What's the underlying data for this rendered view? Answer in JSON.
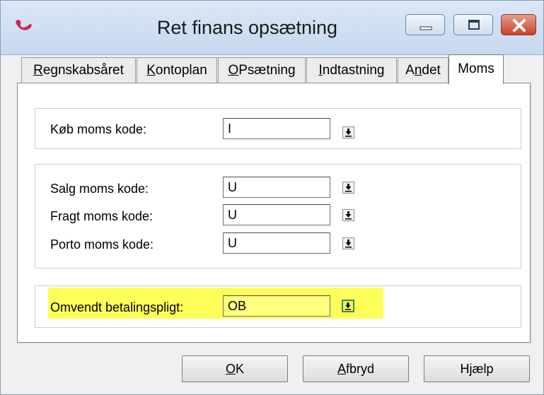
{
  "window": {
    "title": "Ret finans opsætning"
  },
  "tabs": [
    {
      "pre": "",
      "ul": "R",
      "post": "egnskabsåret"
    },
    {
      "pre": "",
      "ul": "K",
      "post": "ontoplan"
    },
    {
      "pre": "",
      "ul": "O",
      "post": "Psætning"
    },
    {
      "pre": "",
      "ul": "I",
      "post": "ndtastning"
    },
    {
      "pre": "A",
      "ul": "n",
      "post": "det"
    },
    {
      "pre": "",
      "ul": "",
      "post": "Moms"
    }
  ],
  "active_tab": "Moms",
  "fields": {
    "kob": {
      "label": "Køb moms kode:",
      "value": "I"
    },
    "salg": {
      "label": "Salg moms kode:",
      "value": "U"
    },
    "fragt": {
      "label": "Fragt moms kode:",
      "value": "U"
    },
    "porto": {
      "label": "Porto moms kode:",
      "value": "U"
    },
    "omvendt": {
      "label": "Omvendt betalingspligt:",
      "value": "OB"
    }
  },
  "buttons": {
    "ok": {
      "ul": "O",
      "post": "K"
    },
    "cancel": {
      "pre": "",
      "ul": "A",
      "post": "fbryd"
    },
    "help": {
      "pre": "H",
      "ul": "j",
      "post": "ælp"
    }
  },
  "colors": {
    "highlight": "#ffff5a",
    "close_button": "#c7422b",
    "titlebar": "#c6d8ef"
  },
  "icons": {
    "app": "app-logo-icon",
    "minimize": "minimize-icon",
    "maximize": "maximize-icon",
    "close": "close-icon",
    "dropdown": "arrow-down-icon"
  }
}
